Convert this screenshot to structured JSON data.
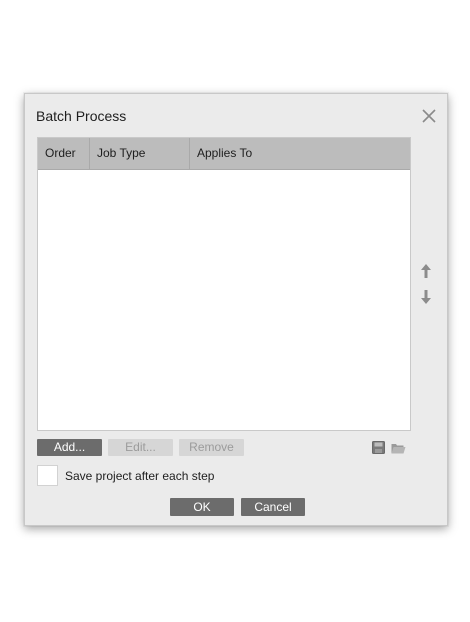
{
  "dialog": {
    "title": "Batch Process",
    "close_icon": "close-icon"
  },
  "table": {
    "columns": [
      "Order",
      "Job Type",
      "Applies To"
    ],
    "rows": []
  },
  "reorder": {
    "up_icon": "arrow-up-icon",
    "down_icon": "arrow-down-icon"
  },
  "actions": {
    "add_label": "Add...",
    "edit_label": "Edit...",
    "remove_label": "Remove",
    "save_icon": "save-icon",
    "open_icon": "folder-open-icon"
  },
  "options": {
    "save_after_step_label": "Save project after each step",
    "save_after_step_checked": false
  },
  "footer": {
    "ok_label": "OK",
    "cancel_label": "Cancel"
  },
  "colors": {
    "dialog_bg": "#ebebeb",
    "header_bg": "#bcbcbc",
    "button_dark": "#6c6c6c",
    "button_disabled": "#d6d6d6"
  }
}
